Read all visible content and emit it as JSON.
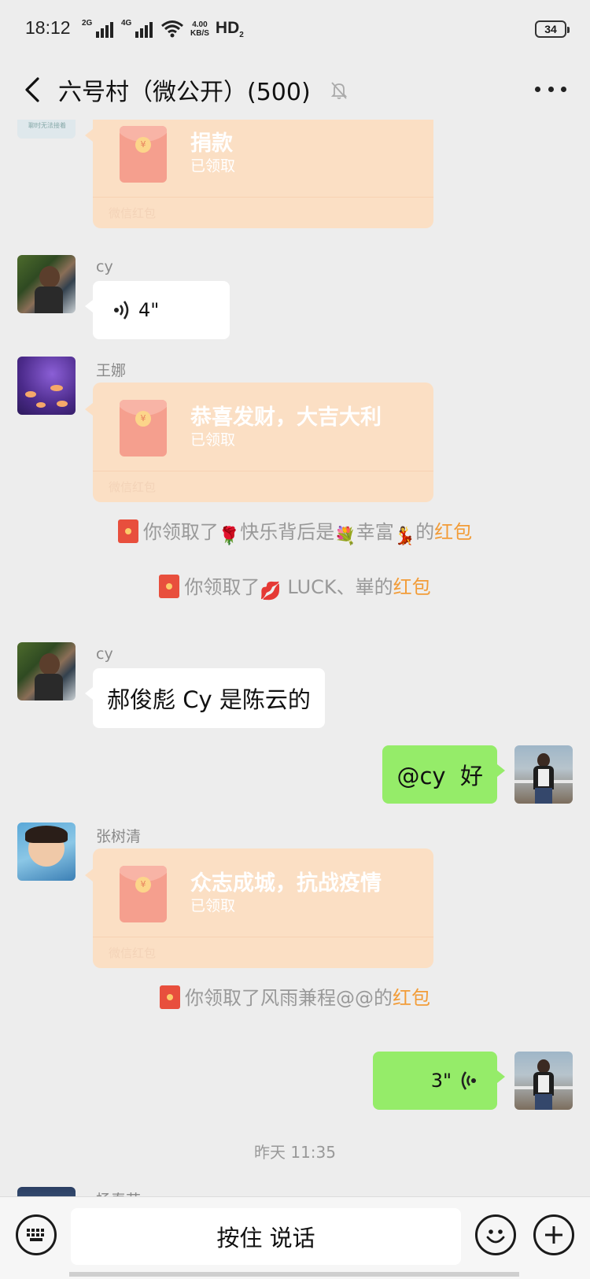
{
  "status_bar": {
    "time": "18:12",
    "net1": "2G",
    "net2": "4G",
    "speed_top": "4.00",
    "speed_bottom": "KB/S",
    "hd": "HD",
    "hd_sub": "2",
    "battery": "34"
  },
  "header": {
    "title": "六号村（微公开）(500)"
  },
  "chat": {
    "msg1": {
      "title": "捐款",
      "status": "已领取",
      "footer": "微信红包",
      "avatar_caption": "聊时无法接着"
    },
    "msg2": {
      "sender": "cy",
      "duration": "4\""
    },
    "msg3": {
      "sender": "王娜",
      "title": "恭喜发财，大吉大利",
      "status": "已领取",
      "footer": "微信红包"
    },
    "sys1": {
      "prefix": "你领取了",
      "name_a": "快乐背后是",
      "name_b": "幸富",
      "suffix": "的",
      "link": "红包",
      "emoji_a": "🌹",
      "emoji_b": "💐",
      "emoji_c": "💃"
    },
    "sys2": {
      "prefix": "你领取了",
      "name": "LUCK、崋",
      "suffix": "的",
      "link": "红包",
      "emoji": "💋"
    },
    "msg4": {
      "sender": "cy",
      "text": "郝俊彪 Cy 是陈云的"
    },
    "msg5": {
      "text": "@cy  好"
    },
    "msg6": {
      "sender": "张树清",
      "title": "众志成城，抗战疫情",
      "status": "已领取",
      "footer": "微信红包"
    },
    "sys3": {
      "prefix": "你领取了",
      "name": "风雨兼程@@",
      "suffix": "的",
      "link": "红包"
    },
    "msg7": {
      "duration": "3\""
    },
    "timestamp": "昨天 11:35",
    "partial_sender": "杨春花"
  },
  "input_bar": {
    "hold_to_talk": "按住 说话"
  },
  "colors": {
    "background": "#ededed",
    "bubble_self": "#95ec69",
    "bubble_other": "#ffffff",
    "red_packet": "#fbdfc4",
    "link": "#f29c38"
  }
}
